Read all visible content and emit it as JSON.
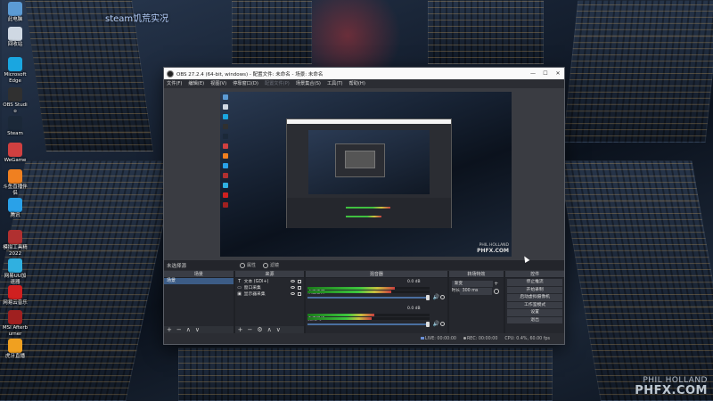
{
  "desktop": {
    "overlay_text": "steam饥荒实况",
    "icons": [
      {
        "label": "此电脑",
        "color": "#5b9bd5"
      },
      {
        "label": "回收站",
        "color": "#cfd8e3"
      },
      {
        "label": "Microsoft Edge",
        "color": "#1aa6e0"
      },
      {
        "label": "OBS Studio",
        "color": "#303030"
      },
      {
        "label": "Steam",
        "color": "#1b2838"
      },
      {
        "label": "WeGame",
        "color": "#d04040"
      },
      {
        "label": "斗鱼直播伴侣",
        "color": "#f08020"
      },
      {
        "label": "腾讯",
        "color": "#2aa1e8"
      },
      {
        "label": "模拟工具精 2022",
        "color": "#b03030"
      },
      {
        "label": "网易UU加速器",
        "color": "#30b0e0"
      },
      {
        "label": "网易云音乐",
        "color": "#d02020"
      },
      {
        "label": "MSI Afterburner",
        "color": "#a02020"
      },
      {
        "label": "虎牙直播",
        "color": "#f0a020"
      }
    ],
    "watermark_top": "PHIL HOLLAND",
    "watermark_bottom": "PHFX.COM"
  },
  "obs": {
    "title": "OBS 27.2.4 (64-bit, windows) - 配置文件: 未命名 - 场景: 未命名",
    "window_buttons": {
      "minimize": "—",
      "maximize": "☐",
      "close": "✕"
    },
    "menu": [
      {
        "label": "文件(F)",
        "dim": false
      },
      {
        "label": "编辑(E)",
        "dim": false
      },
      {
        "label": "视图(V)",
        "dim": false
      },
      {
        "label": "停靠窗口(D)",
        "dim": false
      },
      {
        "label": "配置文件(P)",
        "dim": true
      },
      {
        "label": "场景集合(S)",
        "dim": false
      },
      {
        "label": "工具(T)",
        "dim": false
      },
      {
        "label": "帮助(H)",
        "dim": false
      }
    ],
    "preview_watermark_top": "PHIL HOLLAND",
    "preview_watermark_bottom": "PHFX.COM",
    "context_bar": {
      "no_source": "未选择源",
      "properties": "属性",
      "filters": "滤镜"
    },
    "docks": {
      "scenes": {
        "title": "场景",
        "items": [
          "场景"
        ]
      },
      "sources": {
        "title": "来源",
        "items": [
          {
            "icon": "T",
            "name": "文本 (GDI+)"
          },
          {
            "icon": "▭",
            "name": "窗口采集"
          },
          {
            "icon": "▣",
            "name": "显示器采集"
          }
        ]
      },
      "mixer": {
        "title": "混音器",
        "tracks": [
          {
            "name": "桌面音频",
            "db": "0.0 dB",
            "level": 0.72
          },
          {
            "name": "麦克风/Aux",
            "db": "0.0 dB",
            "level": 0.55
          }
        ]
      },
      "transitions": {
        "title": "转场特效",
        "selected": "渐变",
        "duration_label": "时长",
        "duration_value": "300 ms"
      },
      "controls": {
        "title": "控件",
        "buttons": [
          "停止推流",
          "开始录制",
          "启动虚拟摄像机",
          "工作室模式",
          "设置",
          "退出"
        ]
      },
      "footer_glyphs": {
        "add": "+",
        "remove": "−",
        "up": "∧",
        "down": "∨",
        "gear": "⚙"
      }
    },
    "status": {
      "live_label": "LIVE:",
      "live_time": "00:00:00",
      "rec_label": "REC:",
      "rec_time": "00:00:00",
      "cpu": "CPU: 0.4%, 60.00 fps"
    }
  }
}
